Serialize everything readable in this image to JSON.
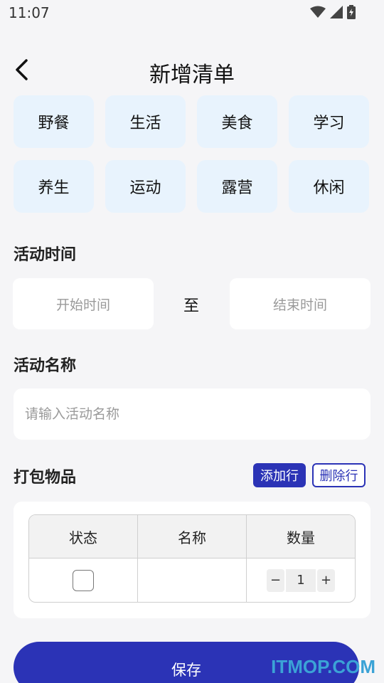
{
  "status_bar": {
    "time": "11:07",
    "icons": [
      "wifi-icon",
      "signal-icon",
      "battery-icon"
    ]
  },
  "header": {
    "title": "新增清单",
    "back_icon": "back-arrow-icon"
  },
  "categories": [
    "野餐",
    "生活",
    "美食",
    "学习",
    "养生",
    "运动",
    "露营",
    "休闲"
  ],
  "activity_time": {
    "label": "活动时间",
    "start_placeholder": "开始时间",
    "separator": "至",
    "end_placeholder": "结束时间"
  },
  "activity_name": {
    "label": "活动名称",
    "placeholder": "请输入活动名称"
  },
  "packing": {
    "label": "打包物品",
    "add_row_label": "添加行",
    "delete_row_label": "删除行",
    "columns": [
      "状态",
      "名称",
      "数量"
    ],
    "rows": [
      {
        "checked": false,
        "name": "",
        "quantity": "1",
        "decrement": "−",
        "increment": "+"
      }
    ]
  },
  "save_label": "保存",
  "watermark": "ITMOP.COM",
  "colors": {
    "accent": "#2b33b6",
    "category_bg": "#e8f3fd",
    "page_bg": "#f5f5f7"
  }
}
